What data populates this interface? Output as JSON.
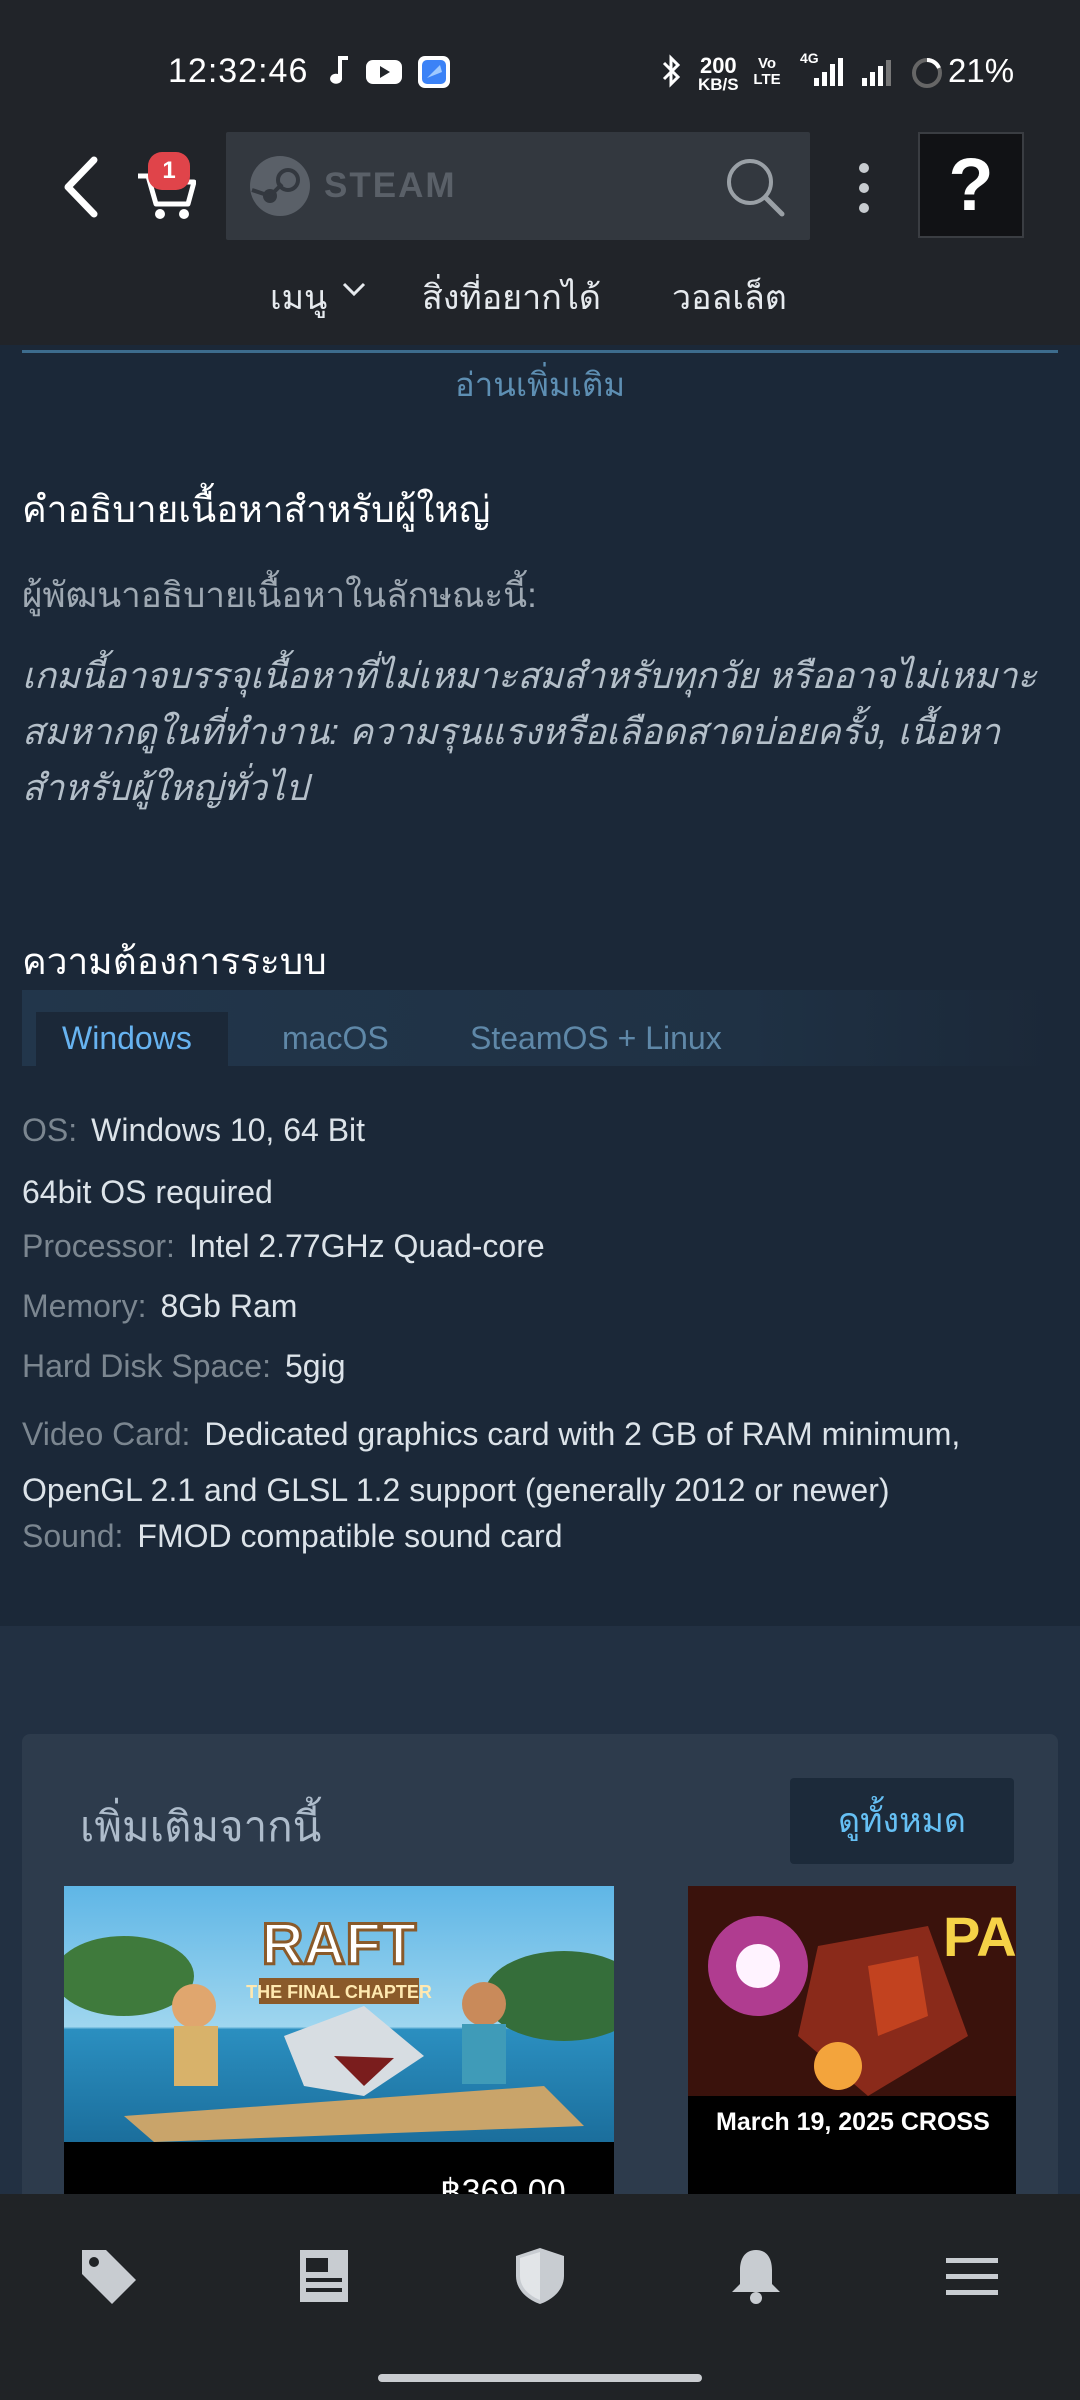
{
  "status_bar": {
    "time": "12:32:46",
    "net_speed_value": "200",
    "net_speed_unit": "KB/S",
    "volte": "Vo LTE",
    "network": "4G",
    "battery": "21%"
  },
  "header": {
    "cart_count": "1",
    "logo_text": "STEAM",
    "help_label": "?",
    "nav": {
      "menu": "เมนู",
      "wishlist": "สิ่งที่อยากได้",
      "wallet": "วอลเล็ต"
    }
  },
  "content": {
    "read_more": "อ่านเพิ่มเติม",
    "mature": {
      "title": "คำอธิบายเนื้อหาสำหรับผู้ใหญ่",
      "subtitle": "ผู้พัฒนาอธิบายเนื้อหาในลักษณะนี้:",
      "body": "เกมนี้อาจบรรจุเนื้อหาที่ไม่เหมาะสมสำหรับทุกวัย หรืออาจไม่เหมาะสมหากดูในที่ทำงาน: ความรุนแรงหรือเลือดสาดบ่อยครั้ง, เนื้อหาสำหรับผู้ใหญ่ทั่วไป"
    },
    "requirements": {
      "title": "ความต้องการระบบ",
      "tabs": [
        "Windows",
        "macOS",
        "SteamOS + Linux"
      ],
      "specs": {
        "os_label": "OS:",
        "os_value": "Windows 10, 64 Bit",
        "note": "64bit OS required",
        "cpu_label": "Processor:",
        "cpu_value": "Intel 2.77GHz Quad-core",
        "mem_label": "Memory:",
        "mem_value": "8Gb Ram",
        "disk_label": "Hard Disk Space:",
        "disk_value": "5gig",
        "gpu_label": "Video Card:",
        "gpu_value": "Dedicated graphics card with 2 GB of RAM minimum, OpenGL 2.1 and GLSL 1.2 support (generally 2012 or newer)",
        "sound_label": "Sound:",
        "sound_value": "FMOD compatible sound card"
      }
    },
    "more_from": {
      "title": "เพิ่มเติมจากนี้",
      "see_all": "ดูทั้งหมด",
      "games": [
        {
          "art_text_1": "RAFT",
          "art_text_2": "THE FINAL CHAPTER",
          "price": "฿369.00"
        },
        {
          "art_text_1": "PA",
          "art_text_2": "March 19, 2025 CROSS"
        }
      ]
    }
  },
  "bottom_nav": {
    "items": [
      "store-tag-icon",
      "news-icon",
      "shield-icon",
      "bell-icon",
      "hamburger-icon"
    ]
  },
  "colors": {
    "background": "#1b2838",
    "header": "#212429",
    "accent_link": "#66c0f4",
    "badge": "#e0444a"
  }
}
